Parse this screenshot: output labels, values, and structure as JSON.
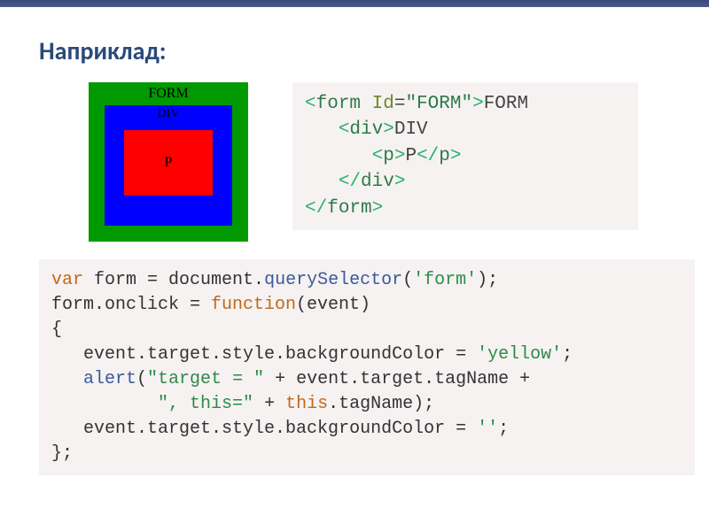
{
  "title": "Наприклад:",
  "demo": {
    "form_label": "FORM",
    "div_label": "DIV",
    "p_label": "P",
    "colors": {
      "form": "#009900",
      "div": "#0000ff",
      "p": "#ff0000"
    }
  },
  "html_code": {
    "l1_open_ang": "<",
    "l1_tag": "form",
    "l1_attr": " Id",
    "l1_eq": "=",
    "l1_val": "\"FORM\"",
    "l1_close_ang": ">",
    "l1_text": "FORM",
    "l2_indent": "   ",
    "l2_open_ang": "<",
    "l2_tag": "div",
    "l2_close_ang": ">",
    "l2_text": "DIV",
    "l3_indent": "      ",
    "l3_open_ang": "<",
    "l3_tag": "p",
    "l3_close_ang": ">",
    "l3_text": "P",
    "l3_open_end_ang": "</",
    "l3_tag_end": "p",
    "l3_end_close": ">",
    "l4_indent": "   ",
    "l4_open_end_ang": "</",
    "l4_tag_end": "div",
    "l4_end_close": ">",
    "l5_open_end_ang": "</",
    "l5_tag_end": "form",
    "l5_end_close": ">"
  },
  "js_code": {
    "l1": {
      "kw_var": "var",
      "sp1": " form = document.",
      "fn1": "querySelector",
      "paren_open": "(",
      "str1": "'form'",
      "paren_close": ");"
    },
    "l2": {
      "t": "form.onclick = ",
      "kw_fn": "function",
      "rest": "(event)"
    },
    "l3": {
      "t": "{"
    },
    "l4": {
      "indent": "   ",
      "t1": "event.target.style.backgroundColor = ",
      "str": "'yellow'",
      "t2": ";"
    },
    "l5": {
      "indent": "   ",
      "fn": "alert",
      "t1": "(",
      "str1": "\"target = \"",
      "t2": " + event.target.tagName +"
    },
    "l6": {
      "indent": "          ",
      "str1": "\", this=\"",
      "t1": " + ",
      "kw_this": "this",
      "t2": ".tagName);"
    },
    "l7": {
      "indent": "   ",
      "t1": "event.target.style.backgroundColor = ",
      "str": "''",
      "t2": ";"
    },
    "l8": {
      "t": "};"
    }
  }
}
